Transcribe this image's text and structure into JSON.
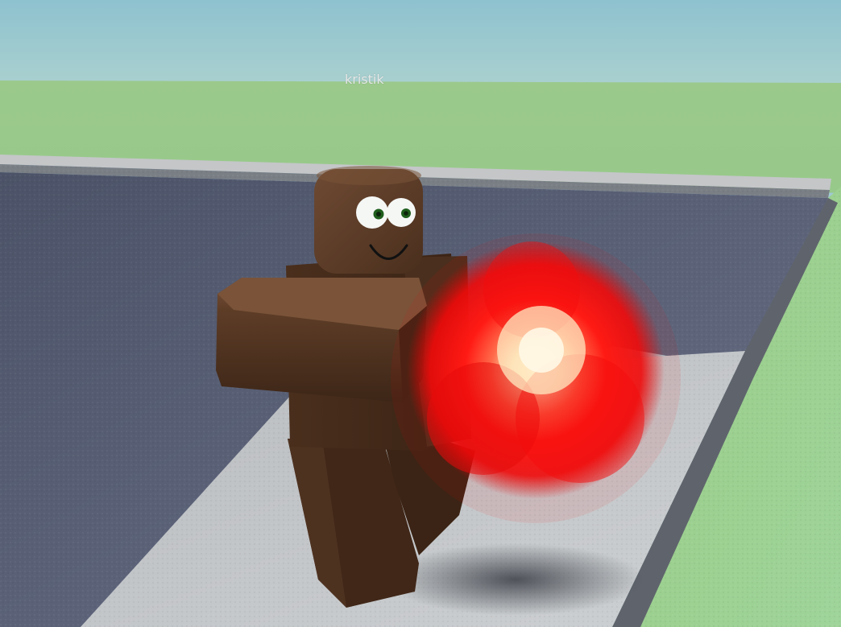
{
  "player": {
    "name": "kristik"
  },
  "colors": {
    "sky": "#9fc9d3",
    "grass": "#9dc98e",
    "road": "#5b6278",
    "sidewalk": "#c9ccce",
    "character_skin": "#5e3d27",
    "fireball_core": "#fff0c8",
    "fireball_glow": "#ff1010"
  },
  "icons": {
    "character": "roblox-avatar",
    "effect": "fireball"
  }
}
